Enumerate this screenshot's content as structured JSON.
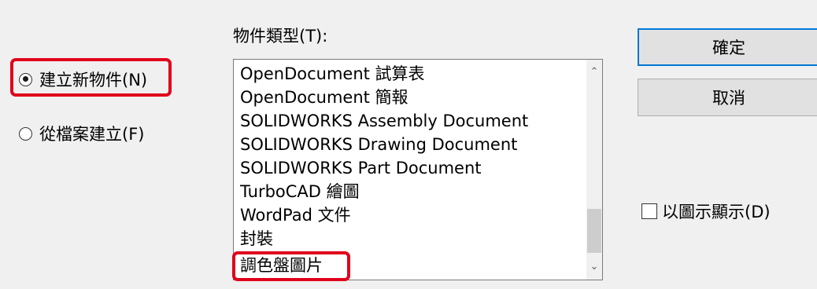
{
  "options": {
    "create_new": "建立新物件(N)",
    "create_from_file": "從檔案建立(F)"
  },
  "object_type": {
    "label": "物件類型(T):",
    "items": [
      "OpenDocument 試算表",
      "OpenDocument 簡報",
      "SOLIDWORKS Assembly Document",
      "SOLIDWORKS Drawing Document",
      "SOLIDWORKS Part Document",
      "TurboCAD 繪圖",
      "WordPad 文件",
      "封裝",
      "調色盤圖片"
    ],
    "selected": "調色盤圖片"
  },
  "buttons": {
    "ok": "確定",
    "cancel": "取消"
  },
  "display_as_icon": {
    "label": "以圖示顯示(D)",
    "checked": false
  },
  "scrollbar": {
    "up_icon": "chevron-up-icon",
    "down_icon": "chevron-down-icon"
  },
  "colors": {
    "highlight": "#e0001b",
    "default_button_border": "#0078d7"
  }
}
